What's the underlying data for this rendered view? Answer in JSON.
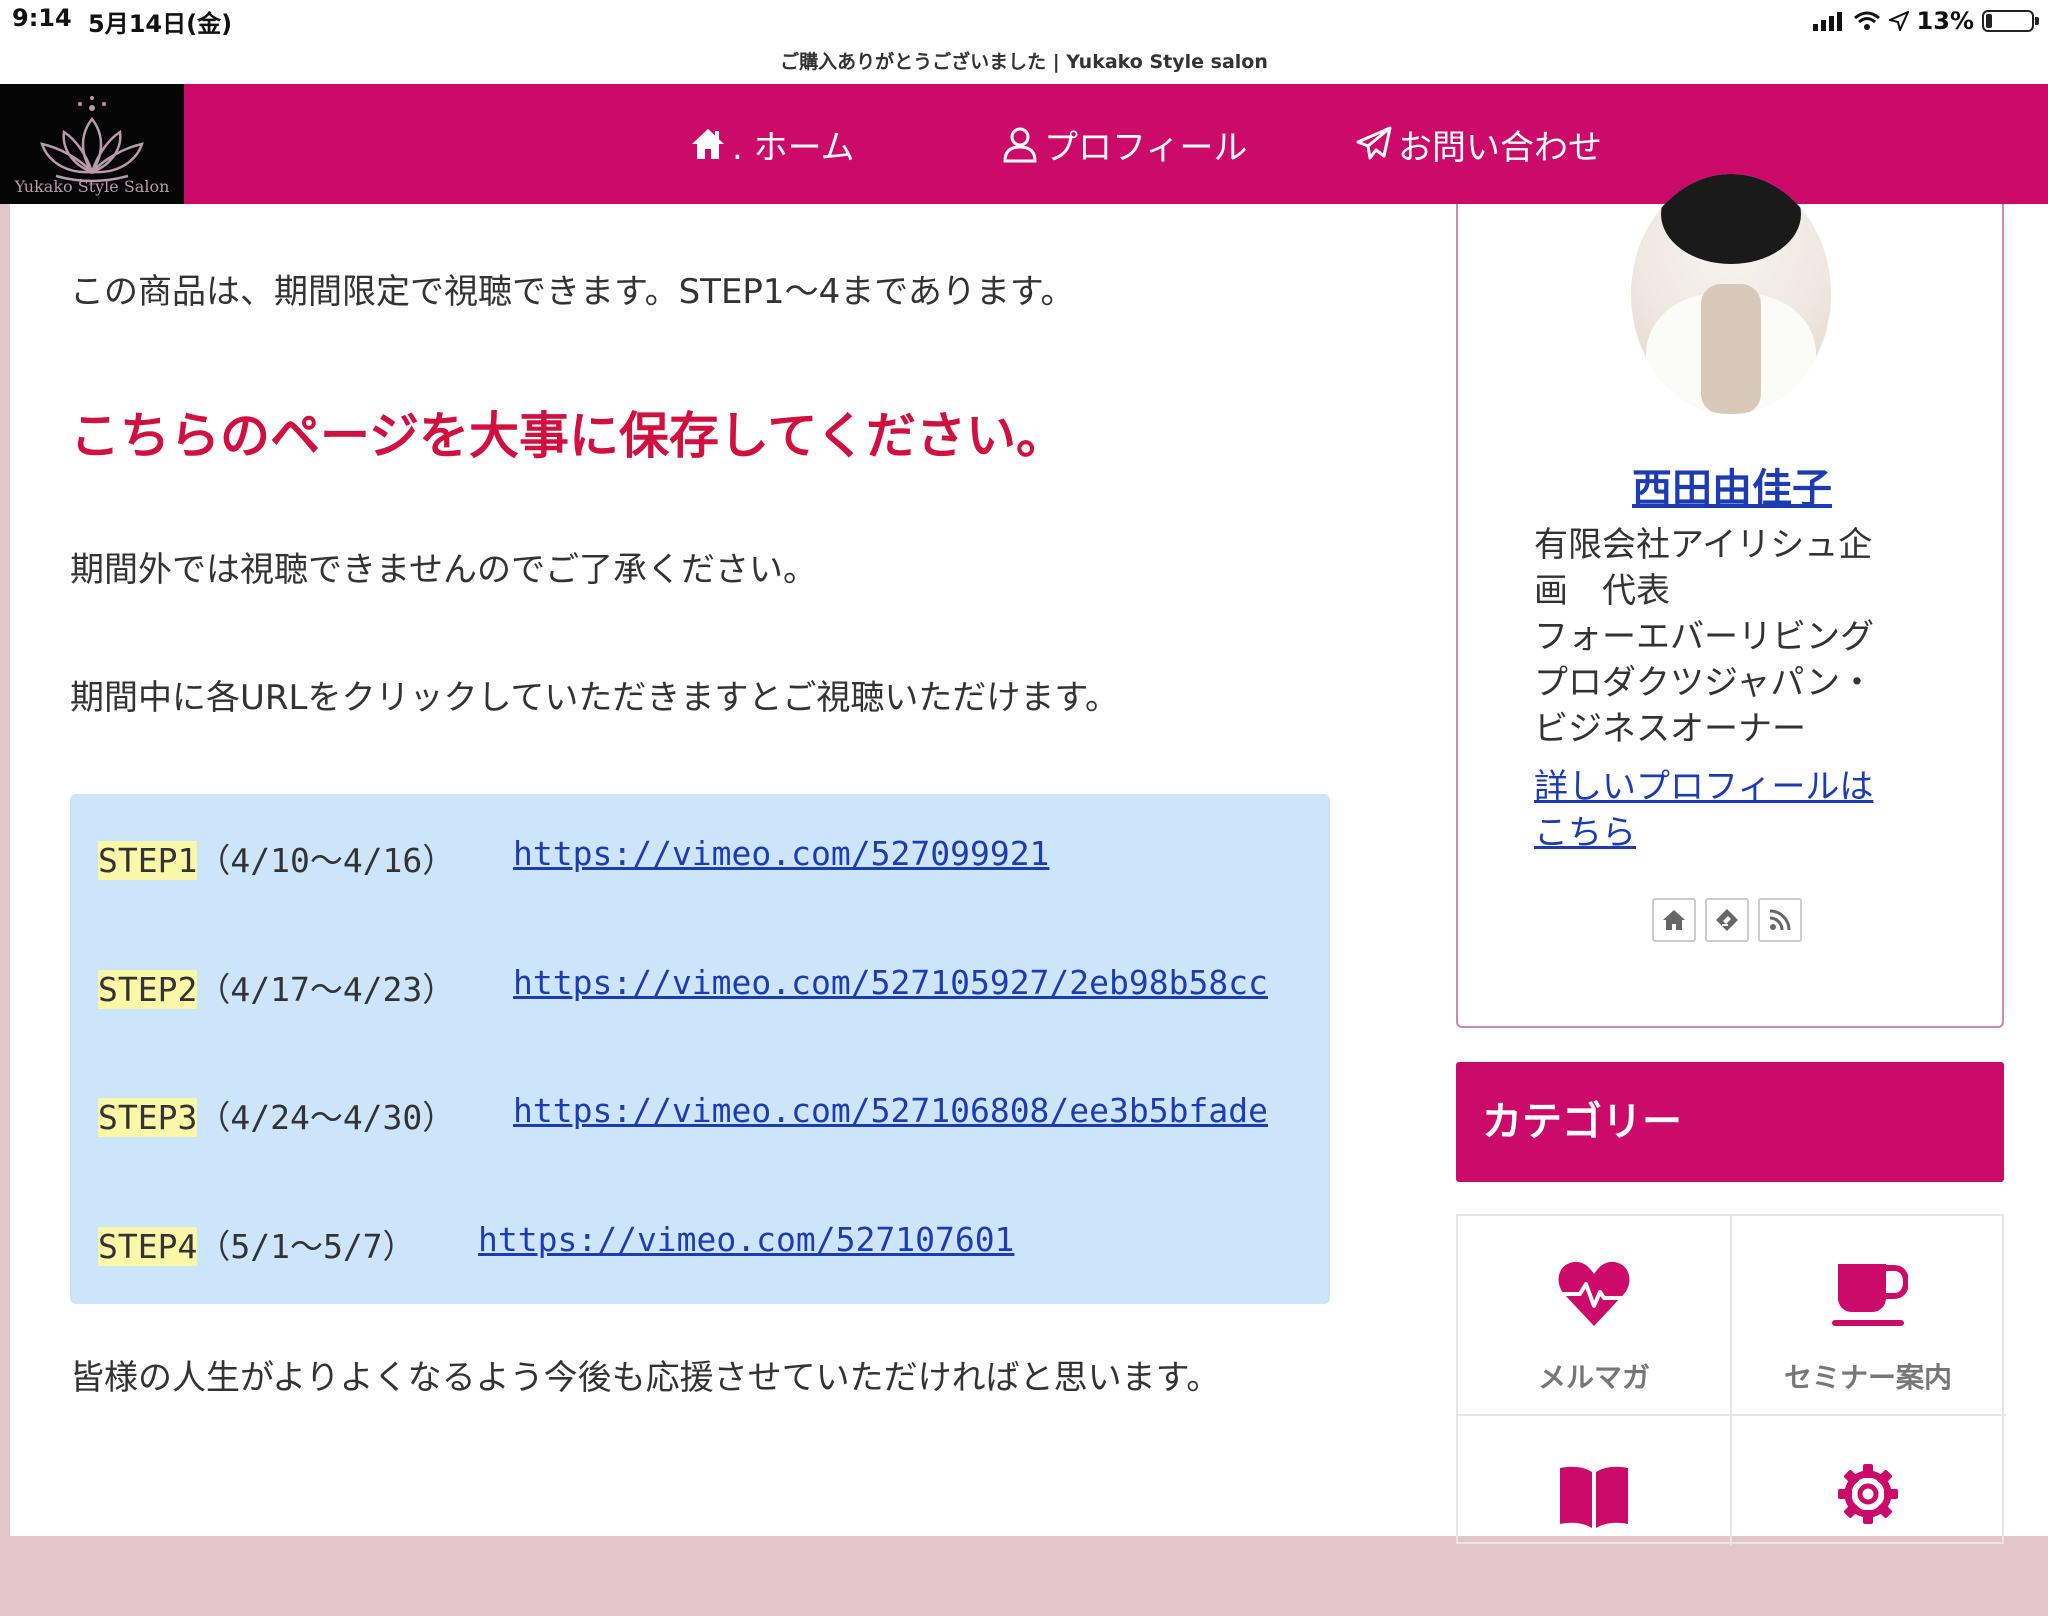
{
  "status_bar": {
    "time": "9:14",
    "date": "5月14日(金)",
    "battery": "13%",
    "battery_level": 0.13
  },
  "browser": {
    "page_title": "ご購入ありがとうございました | Yukako Style salon"
  },
  "header": {
    "logo_text": "Yukako Style Salon",
    "nav": [
      {
        "label": ". ホーム",
        "icon": "home-icon"
      },
      {
        "label": "プロフィール",
        "icon": "user-icon"
      },
      {
        "label": "お問い合わせ",
        "icon": "paper-plane-icon"
      }
    ]
  },
  "content": {
    "intro": "この商品は、期間限定で視聴できます。STEP1～4まであります。",
    "notice": "こちらのページを大事に保存してください。",
    "caution": "期間外では視聴できませんのでご了承ください。",
    "instruction": "期間中に各URLをクリックしていただきますとご視聴いただけます。",
    "steps": [
      {
        "label": "STEP1",
        "period": "（4/10～4/16）",
        "url": "https://vimeo.com/527099921"
      },
      {
        "label": "STEP2",
        "period": "（4/17～4/23）",
        "url": "https://vimeo.com/527105927/2eb98b58cc"
      },
      {
        "label": "STEP3",
        "period": "（4/24～4/30）",
        "url": "https://vimeo.com/527106808/ee3b5bfade"
      },
      {
        "label": "STEP4",
        "period": "（5/1～5/7）",
        "url": "https://vimeo.com/527107601"
      }
    ],
    "closing": "皆様の人生がよりよくなるよう今後も応援させていただければと思います。"
  },
  "sidebar": {
    "profile": {
      "name": "西田由佳子",
      "description_lines": [
        "有限会社アイリシュ企",
        "画　代表",
        "フォーエバーリビング",
        "プロダクツジャパン・",
        "ビジネスオーナー"
      ],
      "more_link_lines": [
        "詳しいプロフィールは",
        "こちら"
      ],
      "social_icons": [
        "home-icon",
        "feedly-icon",
        "rss-icon"
      ]
    },
    "category_title": "カテゴリー",
    "categories": [
      {
        "label": "メルマガ",
        "icon": "heartbeat-icon"
      },
      {
        "label": "セミナー案内",
        "icon": "coffee-cup-icon"
      },
      {
        "label": "",
        "icon": "book-icon"
      },
      {
        "label": "",
        "icon": "gear-icon"
      }
    ]
  },
  "colors": {
    "brand": "#cc0a6a",
    "notice_red": "#d0113f",
    "link": "#1d3bb3",
    "step_box": "#cde5fa",
    "highlight": "#fbf7a9"
  }
}
